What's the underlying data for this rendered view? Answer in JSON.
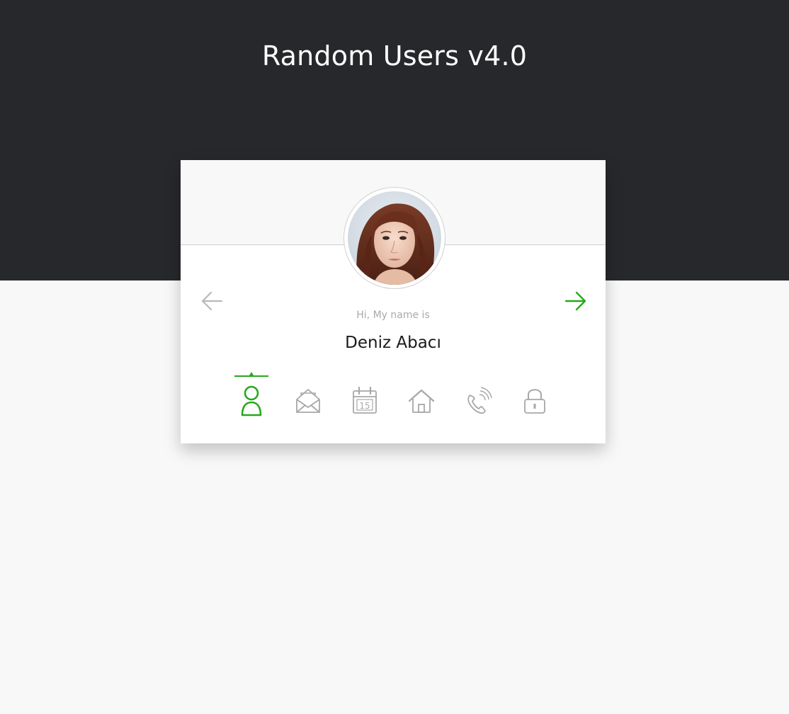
{
  "header": {
    "title": "Random Users v4.0"
  },
  "card": {
    "greeting": "Hi, My name is",
    "name": "Deniz Abacı",
    "active_tab": "name"
  },
  "navigation": {
    "prev_icon": "arrow-left-icon",
    "next_icon": "arrow-right-icon"
  },
  "tabs": [
    {
      "id": "name",
      "icon": "user-icon",
      "active": true
    },
    {
      "id": "email",
      "icon": "envelope-icon",
      "active": false
    },
    {
      "id": "birthday",
      "icon": "calendar-icon",
      "active": false,
      "calendar_day": "15"
    },
    {
      "id": "address",
      "icon": "home-icon",
      "active": false
    },
    {
      "id": "phone",
      "icon": "phone-icon",
      "active": false
    },
    {
      "id": "password",
      "icon": "lock-icon",
      "active": false
    }
  ],
  "colors": {
    "accent": "#28a81c",
    "inactive_icon": "#a8a8a8",
    "header_bg": "#27282b",
    "page_bg": "#f8f8f8",
    "greeting_text": "#a9a9a9"
  }
}
